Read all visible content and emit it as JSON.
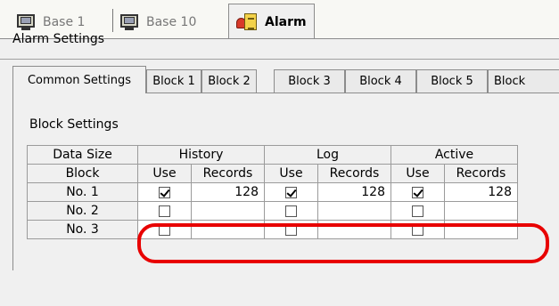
{
  "document_tabs": [
    {
      "label": "Base 1",
      "icon": "monitor-icon",
      "active": false
    },
    {
      "label": "Base 10",
      "icon": "monitor-icon",
      "active": false
    },
    {
      "label": "Alarm",
      "icon": "alarm-icon",
      "active": true
    }
  ],
  "panel": {
    "title": "Alarm Settings",
    "setting_tabs": [
      "Common Settings",
      "Block 1",
      "Block 2",
      "Block 3",
      "Block 4",
      "Block 5",
      "Block"
    ],
    "active_setting_tab": "Common Settings",
    "group_title": "Block Settings"
  },
  "grid": {
    "header_row1": [
      "Data Size",
      "History",
      "Log",
      "Active"
    ],
    "header_row2": [
      "Block",
      "Use",
      "Records",
      "Use",
      "Records",
      "Use",
      "Records"
    ],
    "rows": [
      {
        "block": "No. 1",
        "history_use": true,
        "history_records": "128",
        "log_use": true,
        "log_records": "128",
        "active_use": true,
        "active_records": "128"
      },
      {
        "block": "No. 2",
        "history_use": false,
        "history_records": "",
        "log_use": false,
        "log_records": "",
        "active_use": false,
        "active_records": ""
      },
      {
        "block": "No. 3",
        "history_use": false,
        "history_records": "",
        "log_use": false,
        "log_records": "",
        "active_use": false,
        "active_records": ""
      }
    ]
  },
  "colors": {
    "highlight": "#e80000",
    "panel_bg": "#f0f0f0",
    "border": "#9b9b9b"
  }
}
